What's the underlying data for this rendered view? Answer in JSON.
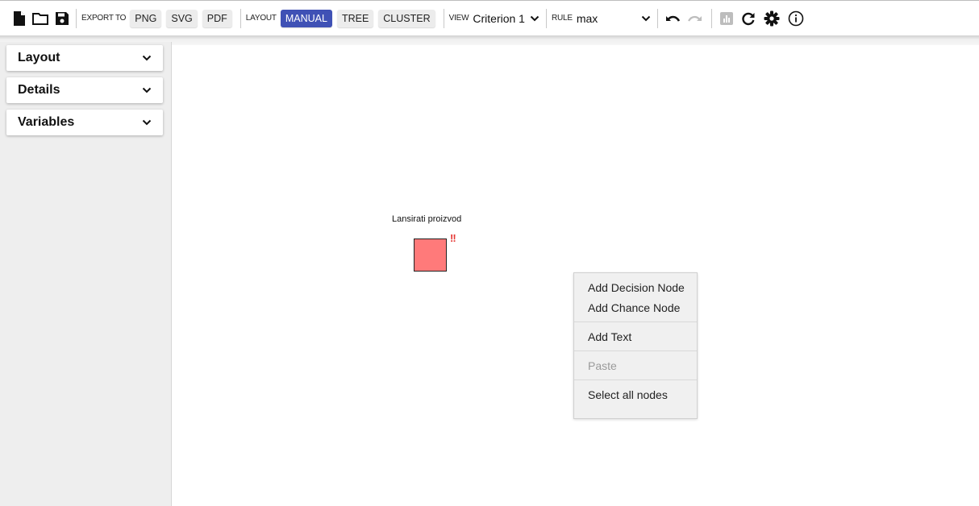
{
  "toolbar": {
    "new_icon": "new-document-icon",
    "open_icon": "folder-icon",
    "save_icon": "save-icon",
    "export_label": "EXPORT TO",
    "export_png": "PNG",
    "export_svg": "SVG",
    "export_pdf": "PDF",
    "layout_label": "LAYOUT",
    "layout_manual": "MANUAL",
    "layout_tree": "TREE",
    "layout_cluster": "CLUSTER",
    "layout_active": "MANUAL",
    "view_label": "VIEW",
    "view_value": "Criterion 1",
    "rule_label": "RULE",
    "rule_value": "max",
    "undo_icon": "undo-icon",
    "redo_icon": "redo-icon",
    "chart_icon": "chart-icon",
    "recompute_icon": "refresh-icon",
    "settings_icon": "gear-icon",
    "about_icon": "info-icon",
    "accent_color": "#3f51b5"
  },
  "sidebar": {
    "panels": [
      {
        "label": "Layout"
      },
      {
        "label": "Details"
      },
      {
        "label": "Variables"
      }
    ]
  },
  "canvas": {
    "node": {
      "label": "Lansirati proizvod",
      "type": "decision",
      "color": "#ff7a7a",
      "warning": "!!"
    }
  },
  "context_menu": {
    "groups": [
      [
        "Add Decision Node",
        "Add Chance Node"
      ],
      [
        "Add Text"
      ],
      [
        "Paste"
      ],
      [
        "Select all nodes"
      ]
    ],
    "disabled": [
      "Paste"
    ]
  }
}
